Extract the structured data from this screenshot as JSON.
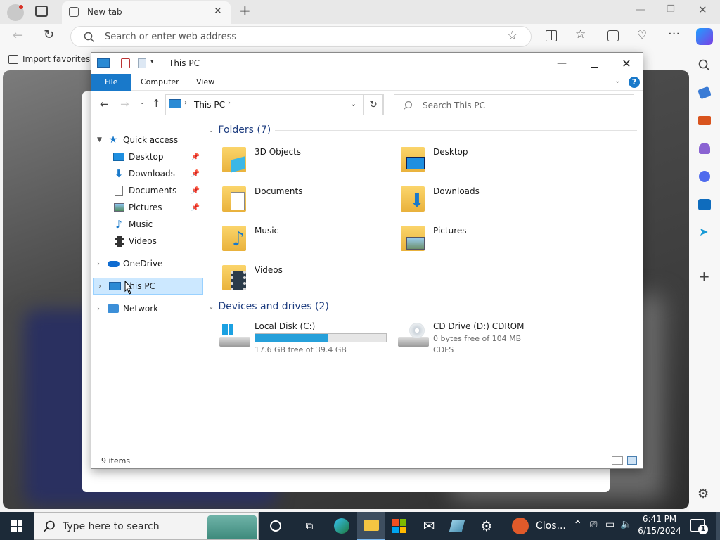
{
  "browser": {
    "tab_title": "New tab",
    "address_placeholder": "Search or enter web address",
    "favorites_label": "Import favorites"
  },
  "explorer": {
    "title": "This PC",
    "ribbon_tabs": [
      "File",
      "Computer",
      "View"
    ],
    "breadcrumb": "This PC",
    "search_placeholder": "Search This PC",
    "nav": {
      "quick_access": "Quick access",
      "quick_items": [
        "Desktop",
        "Downloads",
        "Documents",
        "Pictures",
        "Music",
        "Videos"
      ],
      "onedrive": "OneDrive",
      "this_pc": "This PC",
      "network": "Network"
    },
    "folders_header": "Folders (7)",
    "folders": [
      "3D Objects",
      "Desktop",
      "Documents",
      "Downloads",
      "Music",
      "Pictures",
      "Videos"
    ],
    "drives_header": "Devices and drives (2)",
    "drives": [
      {
        "name": "Local Disk (C:)",
        "free": "17.6 GB free of 39.4 GB",
        "used_fraction": 0.553
      },
      {
        "name": "CD Drive (D:) CDROM",
        "free": "0 bytes free of 104 MB",
        "fs": "CDFS"
      }
    ],
    "status": "9 items"
  },
  "taskbar": {
    "search_placeholder": "Type here to search",
    "notification_label": "Clos...",
    "time": "6:41 PM",
    "date": "6/15/2024",
    "notification_count": "1"
  },
  "colors": {
    "accent": "#1979ca",
    "selection": "#cce8ff",
    "taskbar": "#1c2a38"
  }
}
